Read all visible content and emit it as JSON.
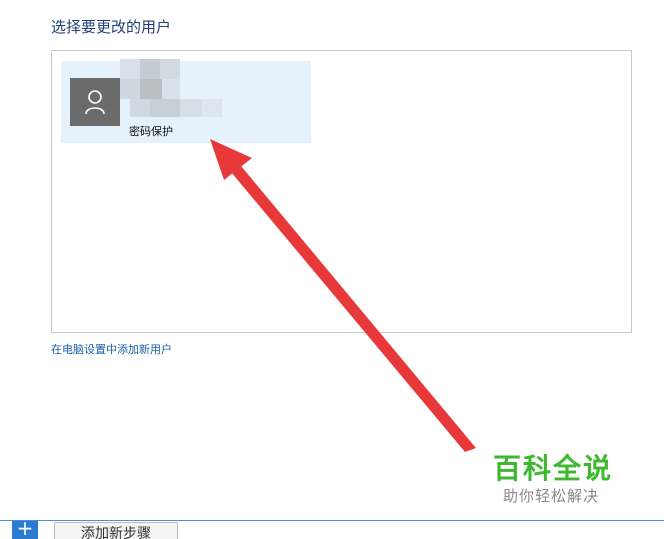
{
  "page": {
    "heading": "选择要更改的用户"
  },
  "user_tile": {
    "account_type": "密码保护",
    "avatar_icon": "user-silhouette-icon"
  },
  "links": {
    "add_user": "在电脑设置中添加新用户"
  },
  "watermark": {
    "title": "百科全说",
    "subtitle": "助你轻松解决"
  },
  "bottom_bar": {
    "plus_label": "+",
    "add_step_label": "添加新步骤"
  },
  "colors": {
    "heading": "#1f3f78",
    "tile_selected": "#e5f1fb",
    "link": "#1a5fa5",
    "arrow": "#e8393a",
    "watermark_green": "#3db82f"
  }
}
